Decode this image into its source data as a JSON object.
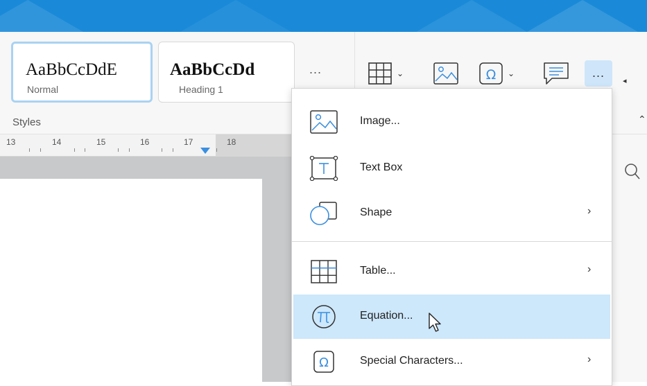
{
  "styles": {
    "group_label": "Styles",
    "cards": [
      {
        "sample": "AaBbCcDdE",
        "name": "Normal"
      },
      {
        "sample": "AaBbCcDd",
        "name": "Heading 1"
      }
    ],
    "more": "..."
  },
  "toolbar": {
    "more": "...",
    "scroll_left": "◂",
    "collapse": "⌃",
    "chevron": "⌄",
    "buttons": [
      "table-icon",
      "image-icon",
      "omega-icon",
      "comment-icon"
    ]
  },
  "ruler": {
    "numbers": [
      "13",
      "14",
      "15",
      "16",
      "17",
      "18"
    ]
  },
  "menu": {
    "items": [
      {
        "icon": "image-icon",
        "label": "Image...",
        "submenu": false
      },
      {
        "icon": "text-box-icon",
        "label": "Text Box",
        "submenu": false
      },
      {
        "icon": "shape-icon",
        "label": "Shape",
        "submenu": true
      },
      {
        "icon": "table-icon",
        "label": "Table...",
        "submenu": true
      },
      {
        "icon": "pi-icon",
        "label": "Equation...",
        "submenu": false,
        "highlighted": true
      },
      {
        "icon": "omega-icon",
        "label": "Special Characters...",
        "submenu": true
      }
    ],
    "submenu_arrow": "›"
  },
  "colors": {
    "title_bar": "#1a8ad8",
    "accent": "#3a8fe0",
    "highlight": "#cde7fb",
    "selected_style_border": "#a9d2f2"
  }
}
